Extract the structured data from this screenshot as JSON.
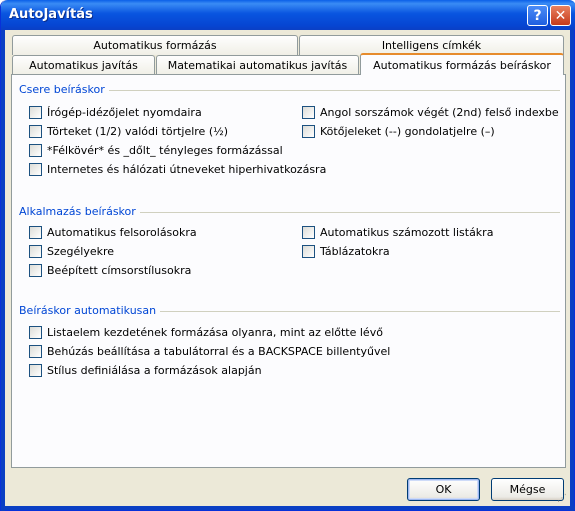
{
  "window": {
    "title": "AutoJavítás",
    "help_glyph": "?",
    "close_glyph": "✕"
  },
  "tabs_row1": [
    {
      "label": "Automatikus formázás"
    },
    {
      "label": "Intelligens címkék"
    }
  ],
  "tabs_row2": [
    {
      "label": "Automatikus javítás"
    },
    {
      "label": "Matematikai automatikus javítás"
    },
    {
      "label": "Automatikus formázás beíráskor"
    }
  ],
  "groups": {
    "replace": {
      "label": "Csere beíráskor",
      "left": [
        {
          "label": "Írógép-idézőjelet nyomdaira",
          "checked": false
        },
        {
          "label": "Törteket (1/2) valódi törtjelre (½)",
          "checked": false
        },
        {
          "label": "*Félkövér* és _dőlt_ tényleges formázással",
          "checked": false
        },
        {
          "label": "Internetes és hálózati útneveket hiperhivatkozásra",
          "checked": false
        }
      ],
      "right": [
        {
          "label": "Angol sorszámok végét (2nd) felső indexbe",
          "checked": false
        },
        {
          "label": "Kötőjeleket (--) gondolatjelre (–)",
          "checked": false
        }
      ]
    },
    "apply": {
      "label": "Alkalmazás beíráskor",
      "left": [
        {
          "label": "Automatikus felsorolásokra",
          "checked": false
        },
        {
          "label": "Szegélyekre",
          "checked": false
        },
        {
          "label": "Beépített címsorstílusokra",
          "checked": false
        }
      ],
      "right": [
        {
          "label": "Automatikus számozott listákra",
          "checked": false
        },
        {
          "label": "Táblázatokra",
          "checked": false
        }
      ]
    },
    "auto": {
      "label": "Beíráskor automatikusan",
      "items": [
        {
          "label": "Listaelem kezdetének formázása olyanra, mint az előtte lévő",
          "checked": false
        },
        {
          "label": "Behúzás beállítása a tabulátorral és a BACKSPACE billentyűvel",
          "checked": false
        },
        {
          "label": "Stílus definiálása a formázások alapján",
          "checked": false
        }
      ]
    }
  },
  "buttons": {
    "ok": "OK",
    "cancel": "Mégse"
  }
}
